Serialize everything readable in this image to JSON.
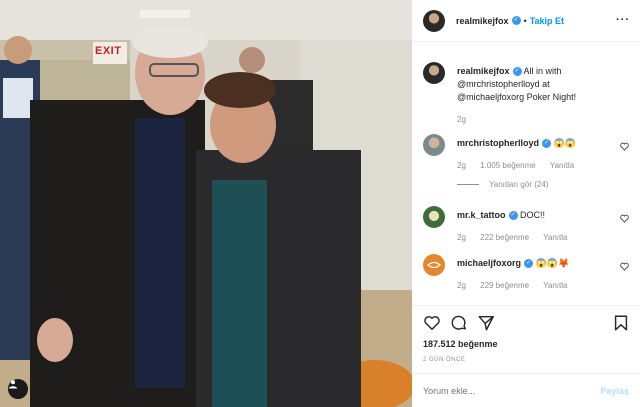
{
  "photo": {
    "alt_scene": "photo",
    "exit_sign": "EXIT",
    "tag_icon": "person-tag-icon"
  },
  "header": {
    "username": "realmikejfox",
    "follow_label": "Takip Et",
    "more_icon": "more-options-icon"
  },
  "caption": {
    "username": "realmikejfox",
    "text": "All in with @mrchristopherlloyd at @michaeljfoxorg Poker Night!",
    "time": "2g"
  },
  "comments": [
    {
      "username": "mrchristopherlloyd",
      "verified": true,
      "text": "😱😱",
      "time": "2g",
      "likes": "1.005 beğenme",
      "reply": "Yanıtla"
    },
    {
      "username": "mr.k_tattoo",
      "verified": true,
      "text": "DOC!!",
      "time": "2g",
      "likes": "222 beğenme",
      "reply": "Yanıtla"
    },
    {
      "username": "michaeljfoxorg",
      "verified": true,
      "text": "😱😱🦊",
      "time": "2g",
      "likes": "229 beğenme",
      "reply": "Yanıtla"
    }
  ],
  "replies_label": "Yanıtları gör (24)",
  "actions": {
    "likes": "187.512 beğenme",
    "ago": "2 GÜN ÖNCE",
    "comment_placeholder": "Yorum ekle...",
    "post_label": "Paylaş"
  },
  "colors": {
    "accent": "#0095f6",
    "verified": "#3897f0",
    "muted": "#8e8e8e"
  }
}
